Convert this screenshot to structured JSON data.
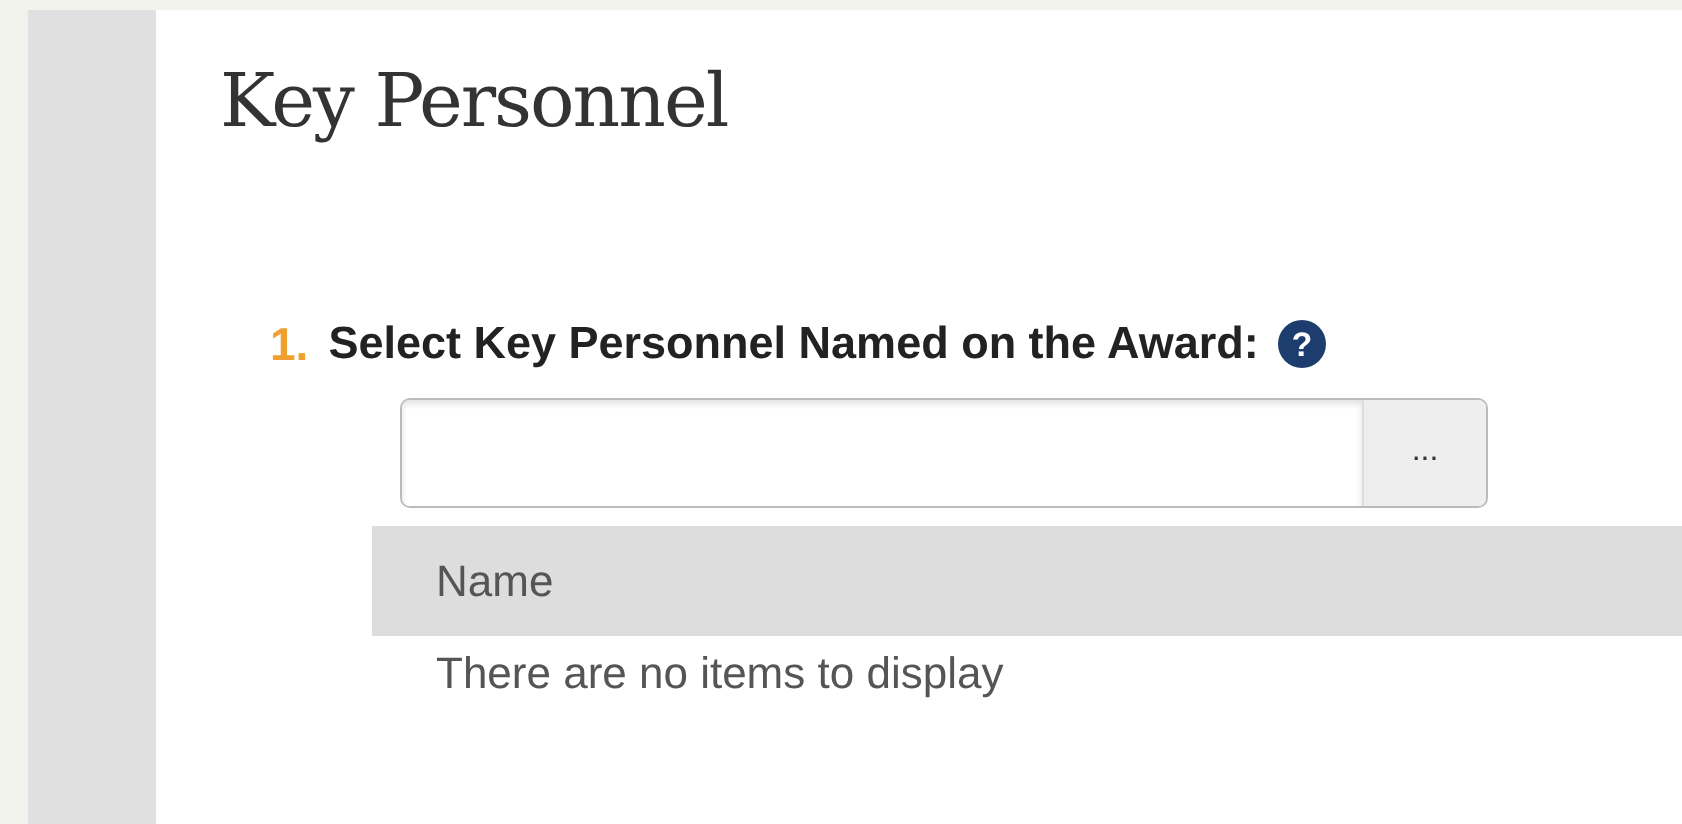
{
  "page": {
    "title": "Key Personnel"
  },
  "question": {
    "number": "1.",
    "label": "Select Key Personnel Named on the Award:",
    "help": "?"
  },
  "lookup": {
    "button": "..."
  },
  "table": {
    "columns": [
      "Name"
    ],
    "empty_message": "There are no items to display"
  }
}
